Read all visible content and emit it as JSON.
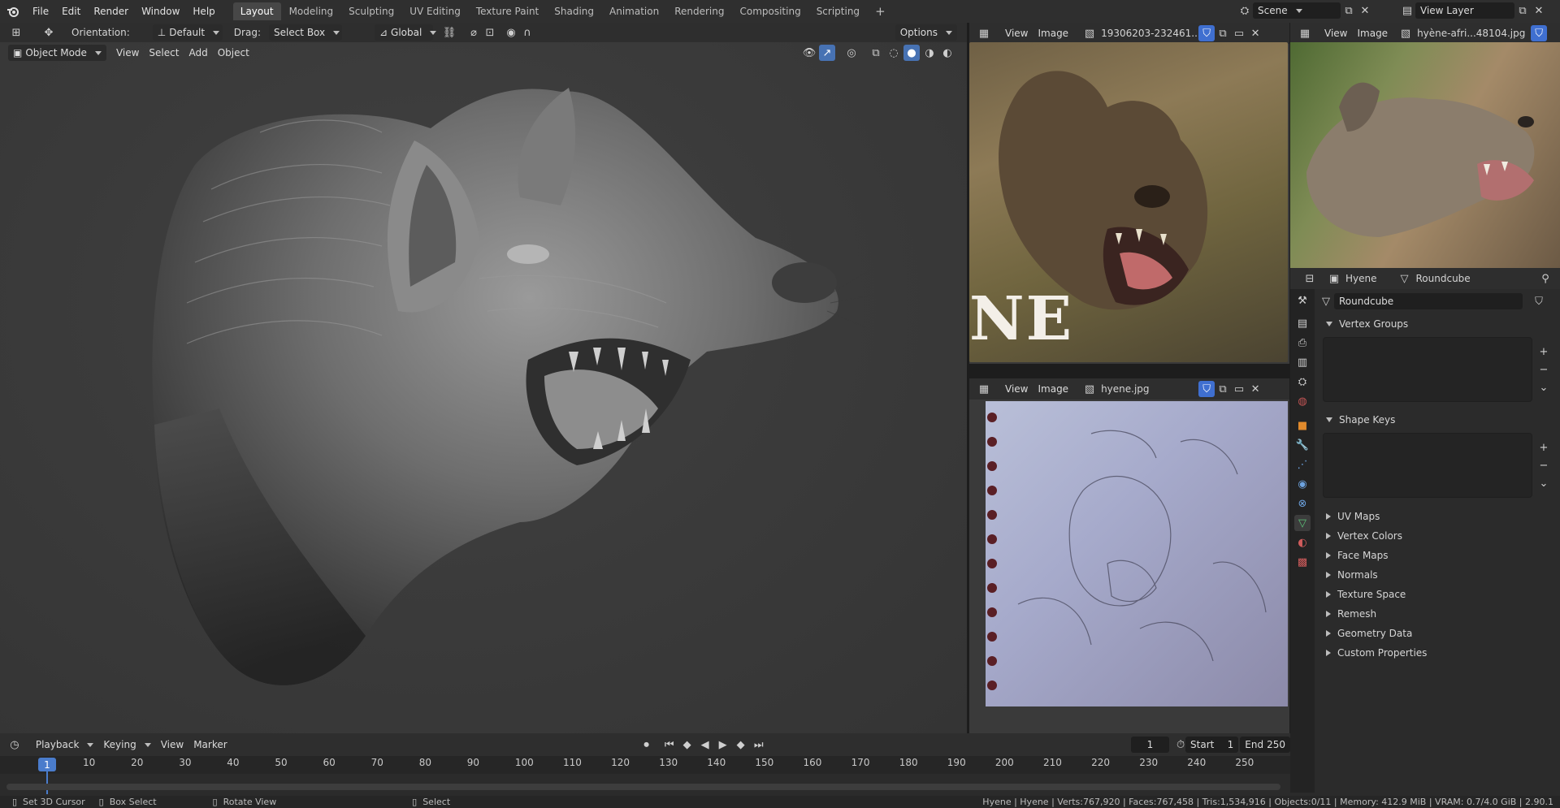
{
  "topbar": {
    "menus": [
      "File",
      "Edit",
      "Render",
      "Window",
      "Help"
    ],
    "workspaces": [
      "Layout",
      "Modeling",
      "Sculpting",
      "UV Editing",
      "Texture Paint",
      "Shading",
      "Animation",
      "Rendering",
      "Compositing",
      "Scripting"
    ],
    "active_workspace": "Layout",
    "add_tab": "+",
    "scene_label": "Scene",
    "view_layer_label": "View Layer"
  },
  "viewport": {
    "orientation_label": "Orientation:",
    "orientation_value": "Default",
    "drag_label": "Drag:",
    "drag_value": "Select Box",
    "transform_value": "Global",
    "options_label": "Options",
    "mode": "Object Mode",
    "menu_view": "View",
    "menu_select": "Select",
    "menu_add": "Add",
    "menu_object": "Object"
  },
  "image_editor_1": {
    "view": "View",
    "image": "Image",
    "filename": "19306203-232461..."
  },
  "image_editor_2": {
    "view": "View",
    "image": "Image",
    "filename": "hyène-afri...48104.jpg"
  },
  "image_editor_3": {
    "view": "View",
    "image": "Image",
    "filename": "hyene.jpg"
  },
  "image_text": "NE",
  "properties": {
    "object_name": "Hyene",
    "data_name": "Roundcube",
    "mesh_name": "Roundcube",
    "sections_open": [
      "Vertex Groups",
      "Shape Keys"
    ],
    "sections_closed": [
      "UV Maps",
      "Vertex Colors",
      "Face Maps",
      "Normals",
      "Texture Space",
      "Remesh",
      "Geometry Data",
      "Custom Properties"
    ]
  },
  "timeline": {
    "menus": [
      "Playback",
      "Keying",
      "View",
      "Marker"
    ],
    "current_frame": "1",
    "start_label": "Start",
    "start_value": "1",
    "end_label": "End",
    "end_value": "250",
    "cursor_frame": "1",
    "ticks": [
      "10",
      "20",
      "30",
      "40",
      "50",
      "60",
      "70",
      "80",
      "90",
      "100",
      "110",
      "120",
      "130",
      "140",
      "150",
      "160",
      "170",
      "180",
      "190",
      "200",
      "210",
      "220",
      "230",
      "240",
      "250"
    ]
  },
  "statusbar": {
    "hint1": "Set 3D Cursor",
    "hint2": "Box Select",
    "hint3": "Rotate View",
    "hint4": "Select",
    "stats": "Hyene | Hyene | Verts:767,920 | Faces:767,458 | Tris:1,534,916 | Objects:0/11 | Memory: 412.9 MiB | VRAM: 0.7/4.0 GiB | 2.90.1"
  },
  "colors": {
    "accent": "#4772b3",
    "active_frame": "#4a7ccc",
    "shield": "#3f6fd0"
  }
}
